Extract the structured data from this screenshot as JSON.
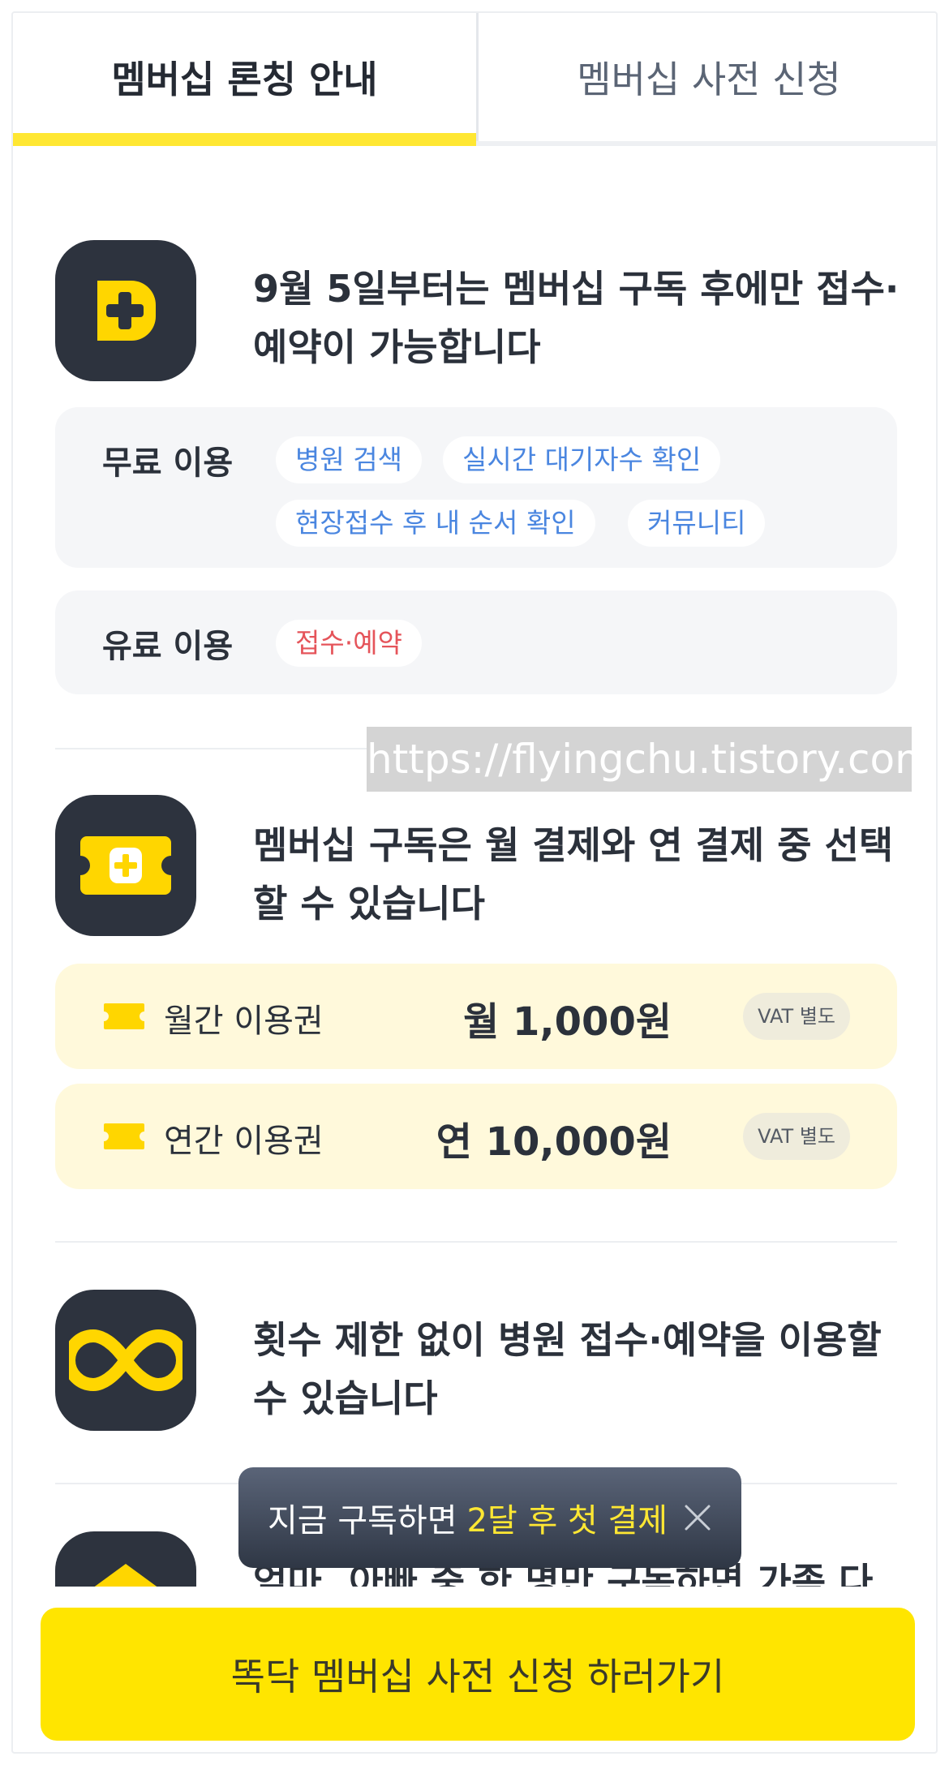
{
  "tabs": [
    {
      "label": "멤버십 론칭 안내",
      "active": true
    },
    {
      "label": "멤버십 사전 신청",
      "active": false
    }
  ],
  "sections": [
    {
      "title": "9월 5일부터는 멤버십 구독 후에만 접수·예약이 가능합니다",
      "icon": "ddokdak-plus-icon"
    },
    {
      "title": "멤버십 구독은 월 결제와 연 결제 중 선택할 수 있습니다",
      "icon": "ticket-icon"
    },
    {
      "title": "횟수 제한 없이 병원 접수·예약을 이용할 수 있습니다",
      "icon": "infinity-icon"
    },
    {
      "title": "엄마, 아빠 중 한 명만 구독하면 가족 다",
      "icon": "house-icon"
    }
  ],
  "free_use": {
    "label": "무료 이용",
    "chips": [
      "병원 검색",
      "실시간 대기자수 확인",
      "현장접수 후 내 순서 확인",
      "커뮤니티"
    ]
  },
  "paid_use": {
    "label": "유료 이용",
    "chips": [
      "접수·예약"
    ]
  },
  "plans": [
    {
      "name": "월간 이용권",
      "price": "월 1,000원",
      "vat": "VAT 별도"
    },
    {
      "name": "연간 이용권",
      "price": "연 10,000원",
      "vat": "VAT 별도"
    }
  ],
  "watermark": "https://flyingchu.tistory.com",
  "toast": {
    "text": "지금 구독하면",
    "highlight": "2달 후 첫 결제"
  },
  "cta": {
    "label": "똑닥 멤버십 사전 신청 하러가기"
  },
  "colors": {
    "accent_yellow": "#ffe500",
    "icon_bg": "#2d333e",
    "free_chip": "#4a86e0",
    "paid_chip": "#e5545a"
  }
}
